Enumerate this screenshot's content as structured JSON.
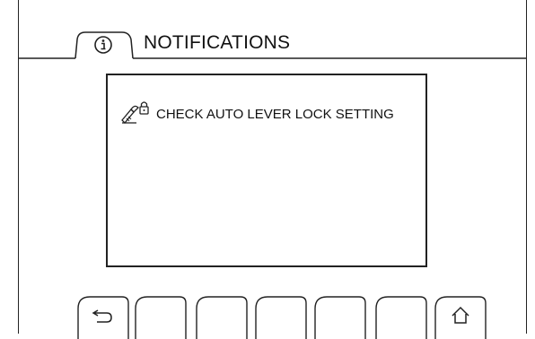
{
  "header": {
    "title": "NOTIFICATIONS",
    "tab_icon": "info-icon"
  },
  "notification": {
    "icon": "lever-lock-icon",
    "text": "CHECK AUTO LEVER LOCK SETTING"
  },
  "softkeys": [
    {
      "icon": "back-icon"
    },
    {
      "icon": ""
    },
    {
      "icon": ""
    },
    {
      "icon": ""
    },
    {
      "icon": ""
    },
    {
      "icon": ""
    },
    {
      "icon": "home-icon"
    }
  ]
}
